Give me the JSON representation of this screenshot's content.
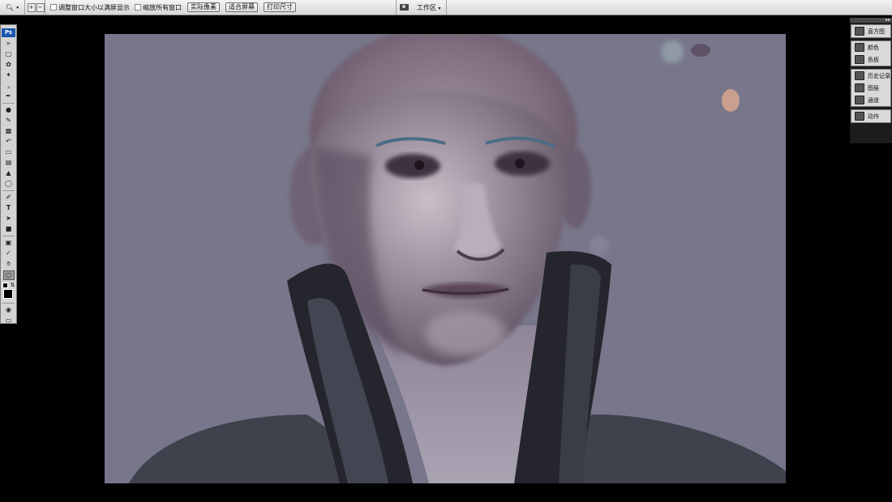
{
  "options_bar": {
    "checkbox_resize": "调整窗口大小以满屏显示",
    "checkbox_zoom_all": "缩放所有窗口",
    "btn_actual_pixels": "实际像素",
    "btn_fit_screen": "适合屏幕",
    "btn_print_size": "打印尺寸",
    "workspace_label": "工作区"
  },
  "toolbox": {
    "logo": "Ps",
    "tools": [
      "move-tool",
      "marquee-tool",
      "lasso-tool",
      "magic-wand-tool",
      "crop-tool",
      "slice-tool",
      "healing-brush-tool",
      "brush-tool",
      "clone-stamp-tool",
      "history-brush-tool",
      "eraser-tool",
      "gradient-tool",
      "blur-tool",
      "dodge-tool",
      "pen-tool",
      "type-tool",
      "path-selection-tool",
      "shape-tool",
      "notes-tool",
      "eyedropper-tool",
      "hand-tool",
      "zoom-tool"
    ],
    "selected_tool": "zoom-tool",
    "foreground_color": "#000000"
  },
  "panels": {
    "group1": [
      "直方图"
    ],
    "group2": [
      "颜色",
      "色板"
    ],
    "group3": [
      "历史记录",
      "图层",
      "通道"
    ],
    "group4": [
      "动作"
    ]
  },
  "colors": {
    "canvas_background": "#78768a",
    "app_background": "#000000",
    "toolbar": "#d4d4d4"
  }
}
